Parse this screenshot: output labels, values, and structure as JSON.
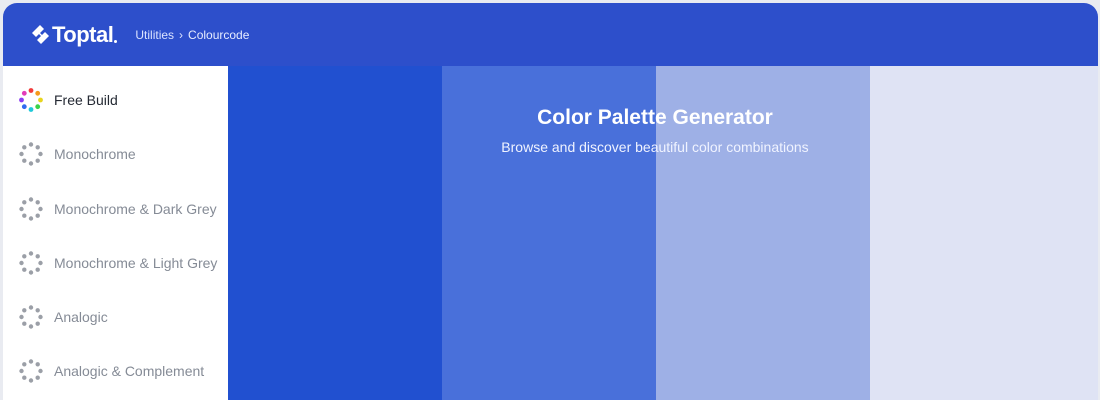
{
  "header": {
    "brand": "Toptal",
    "breadcrumb": {
      "parent": "Utilities",
      "separator": "›",
      "current": "Colourcode"
    },
    "background_color": "#2d4fcb"
  },
  "sidebar": {
    "items": [
      {
        "label": "Free Build",
        "icon": "color-wheel-icon",
        "active": true
      },
      {
        "label": "Monochrome",
        "icon": "dots-circle-icon",
        "active": false
      },
      {
        "label": "Monochrome & Dark Grey",
        "icon": "dots-circle-icon",
        "active": false
      },
      {
        "label": "Monochrome & Light Grey",
        "icon": "dots-circle-icon",
        "active": false
      },
      {
        "label": "Analogic",
        "icon": "dots-circle-icon",
        "active": false
      },
      {
        "label": "Analogic & Complement",
        "icon": "dots-circle-icon",
        "active": false
      }
    ]
  },
  "hero": {
    "title": "Color Palette Generator",
    "subtitle": "Browse and discover beautiful color combinations"
  },
  "palette": {
    "swatches": [
      "#2150d0",
      "#4970da",
      "#9eb0e6",
      "#dfe3f4"
    ]
  }
}
